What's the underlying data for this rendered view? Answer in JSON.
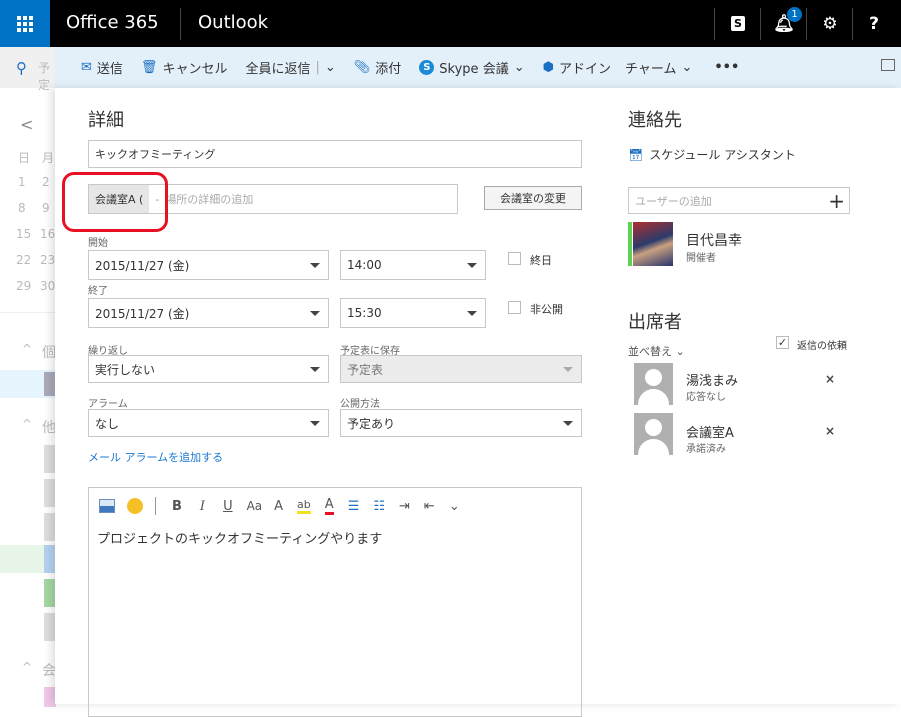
{
  "topbar": {
    "brand": "Office 365",
    "app": "Outlook",
    "notification_count": "1",
    "help": "?"
  },
  "toolbar": {
    "search_placeholder": "予定",
    "send": "送信",
    "cancel": "キャンセル",
    "reply_all": "全員に返信",
    "attach": "添付",
    "skype": "Skype 会議",
    "addin": "アドイン",
    "charm": "チャーム",
    "more": "•••"
  },
  "calendar": {
    "prev": "<",
    "day_headers": [
      "日",
      "月"
    ],
    "rows": [
      [
        "1",
        "2"
      ],
      [
        "8",
        "9"
      ],
      [
        "15",
        "16"
      ],
      [
        "22",
        "23"
      ],
      [
        "29",
        "30"
      ]
    ],
    "sections": [
      "個",
      "他",
      "会"
    ]
  },
  "details": {
    "heading": "詳細",
    "title_value": "キックオフミーティング",
    "location_chip": "会議室A (",
    "location_sep": "-",
    "location_placeholder": "場所の詳細の追加",
    "change_room": "会議室の変更",
    "start_label": "開始",
    "start_date": "2015/11/27 (金)",
    "start_time": "14:00",
    "all_day": "終日",
    "end_label": "終了",
    "end_date": "2015/11/27 (金)",
    "end_time": "15:30",
    "private": "非公開",
    "repeat_label": "繰り返し",
    "repeat_value": "実行しない",
    "save_to_label": "予定表に保存",
    "save_to_value": "予定表",
    "alarm_label": "アラーム",
    "alarm_value": "なし",
    "show_as_label": "公開方法",
    "show_as_value": "予定あり",
    "add_mail_alarm": "メール アラームを追加する",
    "body_text": "プロジェクトのキックオフミーティングやります"
  },
  "editor_toolbar": {
    "bold": "B",
    "italic": "I",
    "underline": "U",
    "font_size": "Aa",
    "grow": "A",
    "font_color": "A"
  },
  "contacts": {
    "heading": "連絡先",
    "schedule_assistant": "スケジュール アシスタント",
    "add_user_placeholder": "ユーザーの追加",
    "organizer": {
      "name": "目代昌幸",
      "role": "開催者"
    }
  },
  "attendees": {
    "heading": "出席者",
    "sort": "並べ替え",
    "request_response": "返信の依頼",
    "request_response_checked": true,
    "items": [
      {
        "name": "湯浅まみ",
        "status": "応答なし"
      },
      {
        "name": "会議室A",
        "status": "承諾済み"
      }
    ]
  },
  "colors": {
    "brand_blue": "#0072c6",
    "toolbar_bg": "#e3eff9",
    "highlight_red": "#e81123",
    "presence_green": "#5dd255"
  }
}
